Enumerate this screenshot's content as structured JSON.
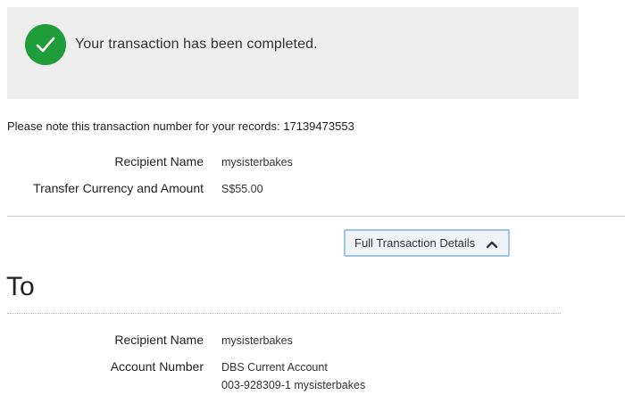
{
  "banner": {
    "message": "Your transaction has been completed.",
    "icon": "checkmark-circle-icon",
    "icon_color": "#1f9d3a"
  },
  "note": {
    "text": "Please note this transaction number for your records: 17139473553"
  },
  "summary": {
    "recipient_label": "Recipient Name",
    "recipient_value": "mysisterbakes",
    "amount_label": "Transfer Currency and Amount",
    "amount_value": "S$55.00"
  },
  "full_details_button": {
    "label": "Full Transaction Details",
    "icon": "chevron-up-icon"
  },
  "to_section": {
    "title": "To",
    "recipient_label": "Recipient Name",
    "recipient_value": "mysisterbakes",
    "account_label": "Account Number",
    "account_type": "DBS Current Account",
    "account_number": "003-928309-1 mysisterbakes"
  }
}
